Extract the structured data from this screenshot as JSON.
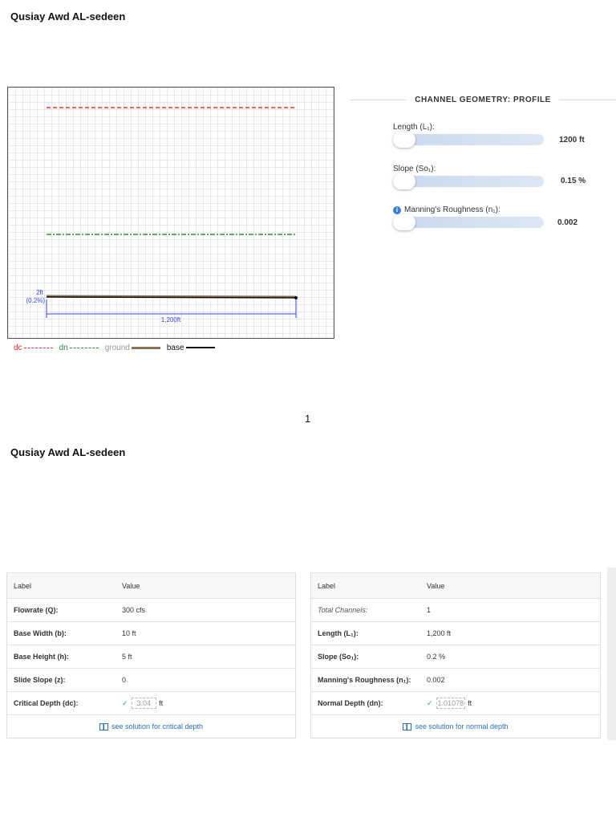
{
  "author": "Qusiay Awd AL-sedeen",
  "page_number": "1",
  "profile_chart": {
    "dim_height": "2ft",
    "dim_slope": "(0.2%)",
    "dim_length": "1,200ft",
    "legend": [
      {
        "label": "dc",
        "color": "#e03030"
      },
      {
        "label": "dn",
        "color": "#2e8b3e"
      },
      {
        "label": "ground",
        "color": "#8b7355"
      },
      {
        "label": "base",
        "color": "#111111"
      }
    ]
  },
  "geometry": {
    "title": "CHANNEL GEOMETRY: PROFILE",
    "length_label": "Length (L₁):",
    "length_value": "1200 ft",
    "slope_label": "Slope (So₁):",
    "slope_value": "0.15 %",
    "roughness_label": "Manning's Roughness (n₁):",
    "roughness_value": "0.002",
    "info_icon": "i"
  },
  "table_left": {
    "headers": [
      "Label",
      "Value"
    ],
    "rows": [
      [
        "Flowrate (Q):",
        "300 cfs"
      ],
      [
        "Base Width (b):",
        "10 ft"
      ],
      [
        "Base Height (h):",
        "5 ft"
      ],
      [
        "Slide Slope (z):",
        "0"
      ]
    ],
    "critical_label": "Critical Depth (dc):",
    "critical_value": "3.04",
    "critical_unit": "ft",
    "link": "see solution for critical depth"
  },
  "table_right": {
    "headers": [
      "Label",
      "Value"
    ],
    "rows": [
      [
        "Total Channels:",
        "1"
      ],
      [
        "Length (L₁):",
        "1,200 ft"
      ],
      [
        "Slope (So₁):",
        "0.2 %"
      ],
      [
        "Manning's Roughness (n₁):",
        "0.002"
      ]
    ],
    "normal_label": "Normal Depth (dn):",
    "normal_value": "1.01078",
    "normal_unit": "ft",
    "link": "see solution for normal depth"
  }
}
